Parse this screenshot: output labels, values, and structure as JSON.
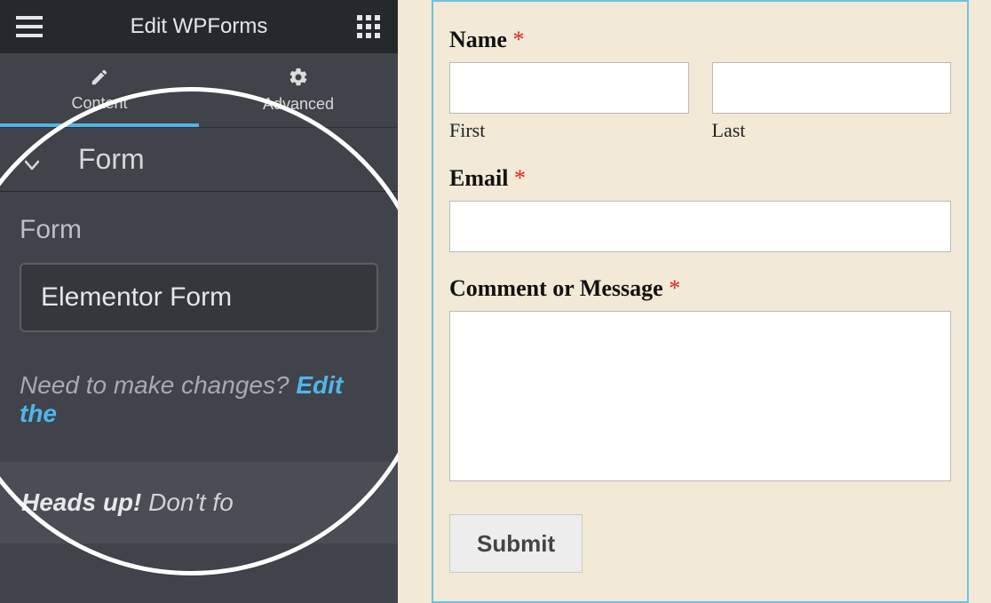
{
  "sidebar": {
    "title": "Edit WPForms",
    "tabs": {
      "content": "Content",
      "advanced": "Advanced"
    },
    "section_header": "Form",
    "form_field_label": "Form",
    "form_selected": "Elementor Form",
    "help_prefix": "Need to make changes? ",
    "help_link": "Edit the",
    "alert_strong": "Heads up!",
    "alert_rest": " Don't fo"
  },
  "preview": {
    "name_label": "Name",
    "first_sublabel": "First",
    "last_sublabel": "Last",
    "email_label": "Email",
    "message_label": "Comment or Message",
    "required_mark": "*",
    "submit": "Submit"
  },
  "colors": {
    "accent": "#4fb6ea",
    "canvas_bg": "#f2ead6",
    "required": "#d22"
  }
}
